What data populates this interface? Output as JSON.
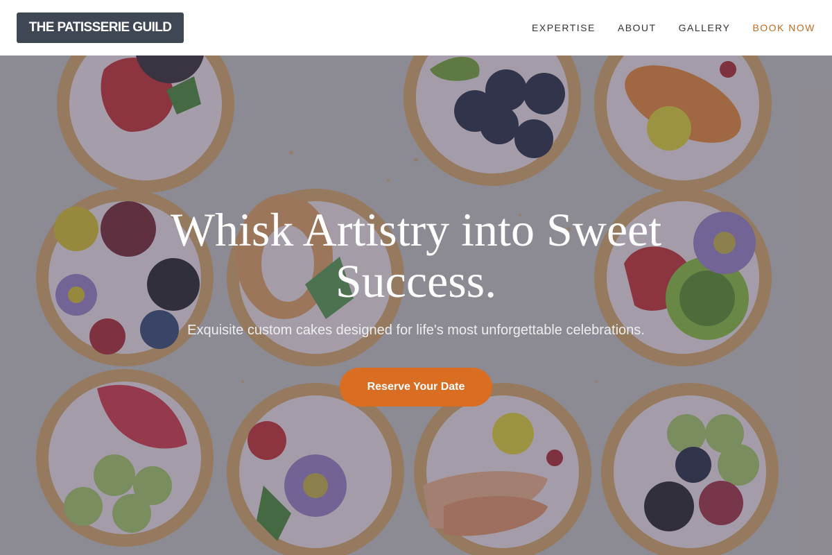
{
  "brand": {
    "name": "THE PATISSERIE GUILD"
  },
  "nav": {
    "items": [
      {
        "label": "EXPERTISE"
      },
      {
        "label": "ABOUT"
      },
      {
        "label": "GALLERY"
      },
      {
        "label": "BOOK NOW"
      }
    ]
  },
  "hero": {
    "title": "Whisk Artistry into Sweet Success.",
    "subtitle": "Exquisite custom cakes designed for life's most unforgettable celebrations.",
    "cta_label": "Reserve Your Date",
    "background": "pastry-tarts-photo"
  },
  "colors": {
    "logo_bg": "#3f4654",
    "accent": "#c06a1f",
    "cta": "#d96e23",
    "overlay": "#3a3c4e"
  }
}
